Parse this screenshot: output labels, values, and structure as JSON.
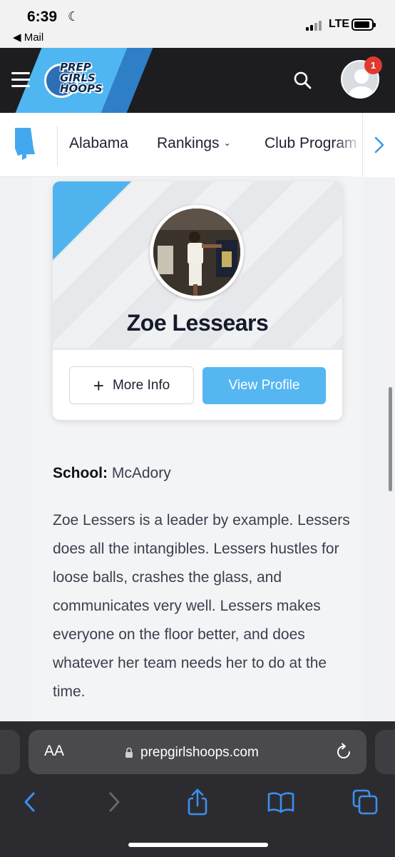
{
  "status_bar": {
    "time": "6:39",
    "back_app": "◀ Mail",
    "network": "LTE"
  },
  "header": {
    "logo_lines": [
      "PREP",
      "GIRLS",
      "HOOPS"
    ],
    "notification_count": "1"
  },
  "subnav": {
    "items": [
      {
        "label": "Alabama"
      },
      {
        "label": "Rankings",
        "has_dropdown": true
      },
      {
        "label": "Club Program"
      }
    ]
  },
  "player_card": {
    "name": "Zoe Lessears",
    "more_info_label": "More Info",
    "view_profile_label": "View Profile"
  },
  "profile": {
    "school_label": "School:",
    "school_value": "McAdory",
    "description": "Zoe Lessers is a leader by example. Lessers does all the intangibles. Lessers hustles for loose balls, crashes the glass, and communicates very well. Lessers makes everyone on the floor better, and does whatever her team needs her to do at the time."
  },
  "browser": {
    "aa_label": "AA",
    "url": "prepgirlshoops.com"
  },
  "colors": {
    "brand_blue": "#4fb6f2",
    "header_bg": "#1d1d20",
    "button_blue": "#55b6f2",
    "badge_red": "#e03a2f"
  }
}
